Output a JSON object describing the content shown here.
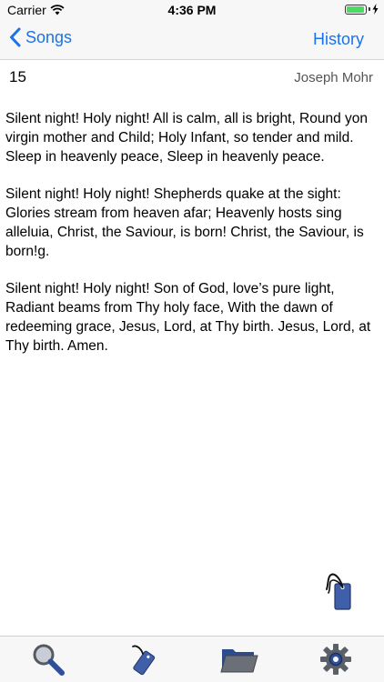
{
  "status_bar": {
    "carrier": "Carrier",
    "time": "4:36 PM",
    "battery_level": 0.95
  },
  "nav": {
    "back_label": "Songs",
    "right_label": "History",
    "accent_color": "#1a73e8"
  },
  "song": {
    "number": "15",
    "author": "Joseph Mohr",
    "verses": [
      "Silent night! Holy night! All is calm, all is bright, Round yon virgin mother and Child; Holy Infant, so tender and mild. Sleep in heavenly peace, Sleep in heavenly peace.",
      "Silent night! Holy night! Shepherds quake at the sight: Glories stream from heaven afar; Heavenly hosts sing alleluia, Christ, the Saviour, is born! Christ, the Saviour, is born!g.",
      "Silent night! Holy night! Son of God, love’s pure light, Radiant beams from Thy holy face, With the dawn of redeeming grace, Jesus, Lord, at Thy birth. Jesus, Lord, at Thy birth.  Amen."
    ]
  },
  "tab_bar": {
    "tabs": [
      {
        "icon": "search-icon"
      },
      {
        "icon": "bookmark-tag-icon"
      },
      {
        "icon": "folder-icon"
      },
      {
        "icon": "settings-gear-icon"
      }
    ]
  }
}
